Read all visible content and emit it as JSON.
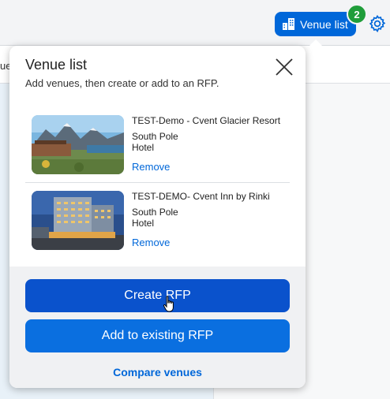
{
  "background": {
    "strip_text": "ue"
  },
  "header": {
    "venue_list_label": "Venue list",
    "venue_count": "2",
    "icons": [
      "building-icon",
      "gear-icon"
    ]
  },
  "popover": {
    "title": "Venue list",
    "subtitle": "Add venues, then create or add to an RFP.",
    "venues": [
      {
        "name": "TEST-Demo - Cvent Glacier Resort",
        "location": "South Pole",
        "type": "Hotel",
        "remove_label": "Remove"
      },
      {
        "name": "TEST-DEMO- Cvent Inn by Rinki",
        "location": "South Pole",
        "type": "Hotel",
        "remove_label": "Remove"
      }
    ],
    "create_rfp_label": "Create RFP",
    "add_existing_label": "Add to existing RFP",
    "compare_label": "Compare venues"
  },
  "colors": {
    "primary": "#0067d9",
    "badge": "#1f9d3a",
    "link": "#0067d9"
  }
}
